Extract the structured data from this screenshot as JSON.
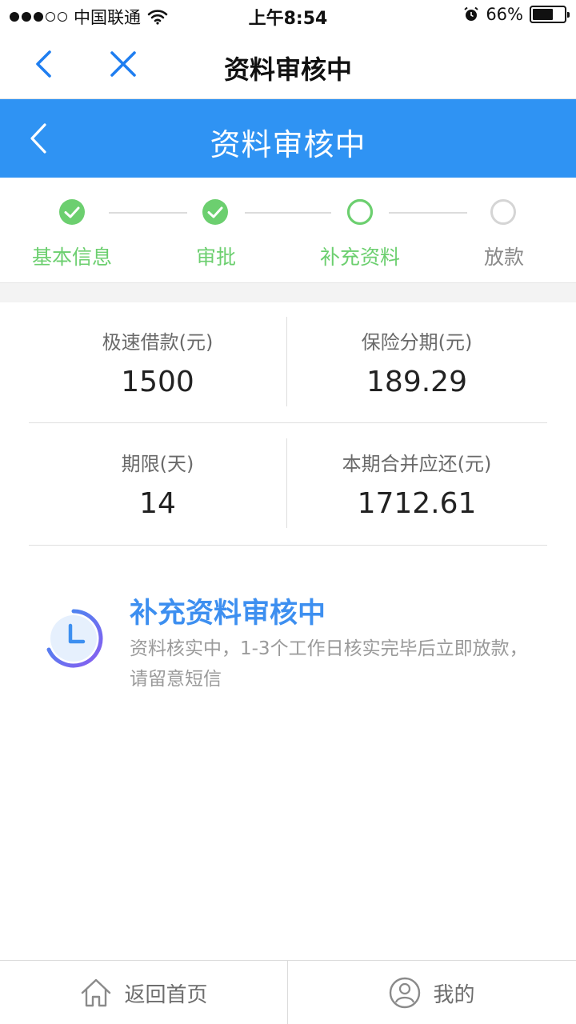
{
  "status_bar": {
    "carrier": "中国联通",
    "time": "上午8:54",
    "battery_text": "66%",
    "battery_level": 0.66
  },
  "nav": {
    "title": "资料审核中",
    "back_icon": "chevron-left-icon",
    "close_icon": "close-icon"
  },
  "header": {
    "title": "资料审核中"
  },
  "steps": [
    {
      "label": "基本信息",
      "state": "done"
    },
    {
      "label": "审批",
      "state": "done"
    },
    {
      "label": "补充资料",
      "state": "current"
    },
    {
      "label": "放款",
      "state": "todo"
    }
  ],
  "summary": {
    "loan_label": "极速借款(元)",
    "loan_value": "1500",
    "insurance_label": "保险分期(元)",
    "insurance_value": "189.29",
    "term_label": "期限(天)",
    "term_value": "14",
    "repay_label": "本期合并应还(元)",
    "repay_value": "1712.61"
  },
  "notice": {
    "heading": "补充资料审核中",
    "description": "资料核实中，1-3个工作日核实完毕后立即放款，请留意短信"
  },
  "tabs": {
    "home_label": "返回首页",
    "mine_label": "我的"
  },
  "colors": {
    "brand_blue": "#2f93f3",
    "step_green": "#6ccf6f",
    "notice_blue": "#3d8ff0",
    "nav_icon_blue": "#1f7ef0"
  }
}
